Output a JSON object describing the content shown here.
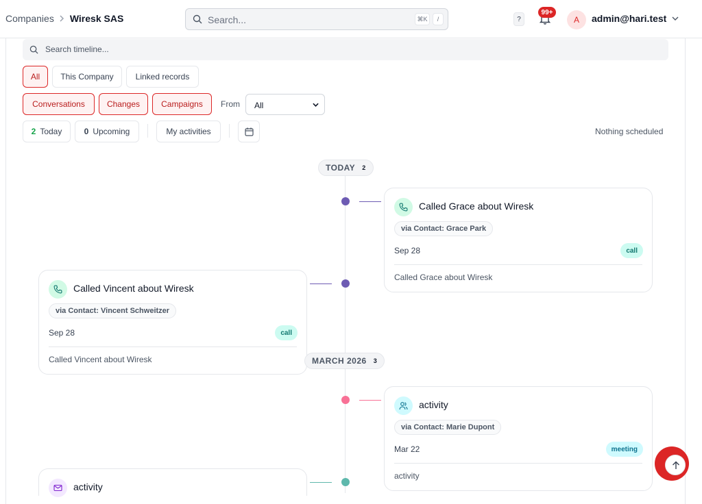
{
  "breadcrumb": {
    "parent": "Companies",
    "current": "Wiresk SAS"
  },
  "global_search": {
    "placeholder": "Search...",
    "shortcut": "⌘K",
    "shortcut_alt": "/"
  },
  "header": {
    "help": "?",
    "notifications_badge": "99+",
    "avatar_initial": "A",
    "user_email": "admin@hari.test"
  },
  "timeline_search": {
    "placeholder": "Search timeline..."
  },
  "scope_filters": [
    {
      "label": "All",
      "active": true
    },
    {
      "label": "This Company",
      "active": false
    },
    {
      "label": "Linked records",
      "active": false
    }
  ],
  "type_filters": [
    {
      "label": "Conversations",
      "active": true
    },
    {
      "label": "Changes",
      "active": true
    },
    {
      "label": "Campaigns",
      "active": true
    }
  ],
  "from": {
    "label": "From",
    "value": "All"
  },
  "activity_bar": {
    "today_count": "2",
    "today_label": "Today",
    "upcoming_count": "0",
    "upcoming_label": "Upcoming",
    "my_activities": "My activities",
    "nothing_scheduled": "Nothing scheduled"
  },
  "groups": [
    {
      "label": "TODAY",
      "count": "2"
    },
    {
      "label": "MARCH 2026",
      "count": "3"
    }
  ],
  "events": [
    {
      "title": "Called Grace about Wiresk",
      "via": "via Contact: Grace Park",
      "date": "Sep 28",
      "tag": "call",
      "description": "Called Grace about Wiresk",
      "icon": "phone-icon",
      "color": "#6d5bb3"
    },
    {
      "title": "Called Vincent about Wiresk",
      "via": "via Contact: Vincent Schweitzer",
      "date": "Sep 28",
      "tag": "call",
      "description": "Called Vincent about Wiresk",
      "icon": "phone-icon",
      "color": "#6d5bb3"
    },
    {
      "title": "activity",
      "via": "via Contact: Marie Dupont",
      "date": "Mar 22",
      "tag": "meeting",
      "description": "activity",
      "icon": "users-icon",
      "color": "#f87196"
    },
    {
      "title": "activity",
      "icon": "mail-icon",
      "color": "#5eb8ac"
    }
  ]
}
